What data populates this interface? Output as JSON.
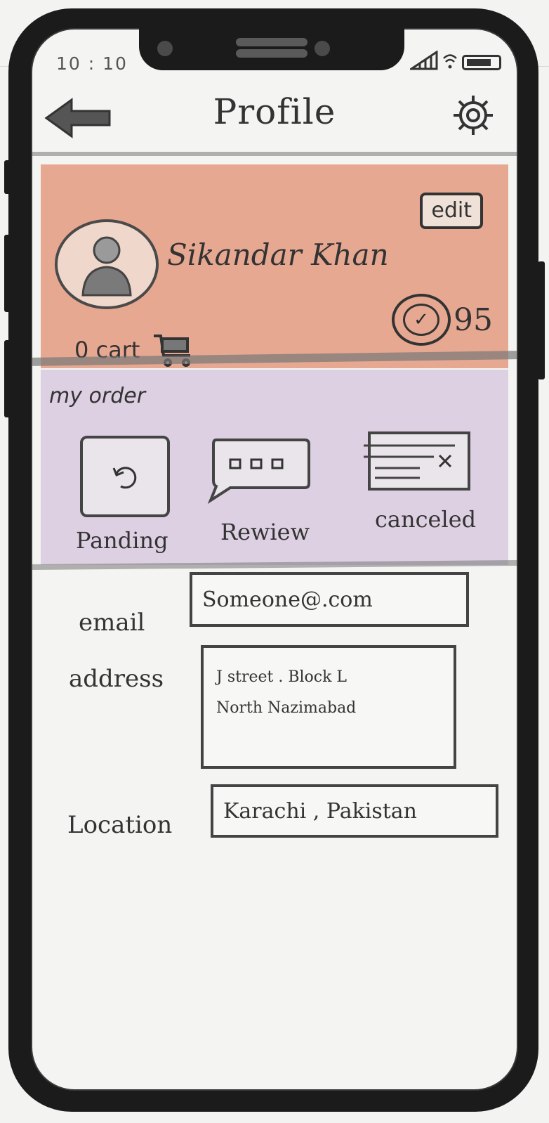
{
  "status_bar": {
    "time": "10 : 10"
  },
  "header": {
    "title": "Profile",
    "back_icon": "arrow-left-icon",
    "settings_icon": "gear-icon"
  },
  "profile": {
    "name": "Sikandar Khan",
    "edit_label": "edit",
    "points": "95",
    "cart_count_text": "0 cart",
    "accent_color": "#e7a892"
  },
  "orders": {
    "title": "my order",
    "accent_color": "#ddd0e2",
    "items": [
      {
        "label": "Panding",
        "icon": "refresh-icon"
      },
      {
        "label": "Rewiew",
        "icon": "chat-bubble-icon"
      },
      {
        "label": "canceled",
        "icon": "cancel-ticket-icon"
      }
    ]
  },
  "form": {
    "email": {
      "label": "email",
      "value": "Someone@.com"
    },
    "address": {
      "label": "address",
      "line1": "J street . Block L",
      "line2": "North Nazimabad"
    },
    "location": {
      "label": "Location",
      "value": "Karachi , Pakistan"
    }
  }
}
